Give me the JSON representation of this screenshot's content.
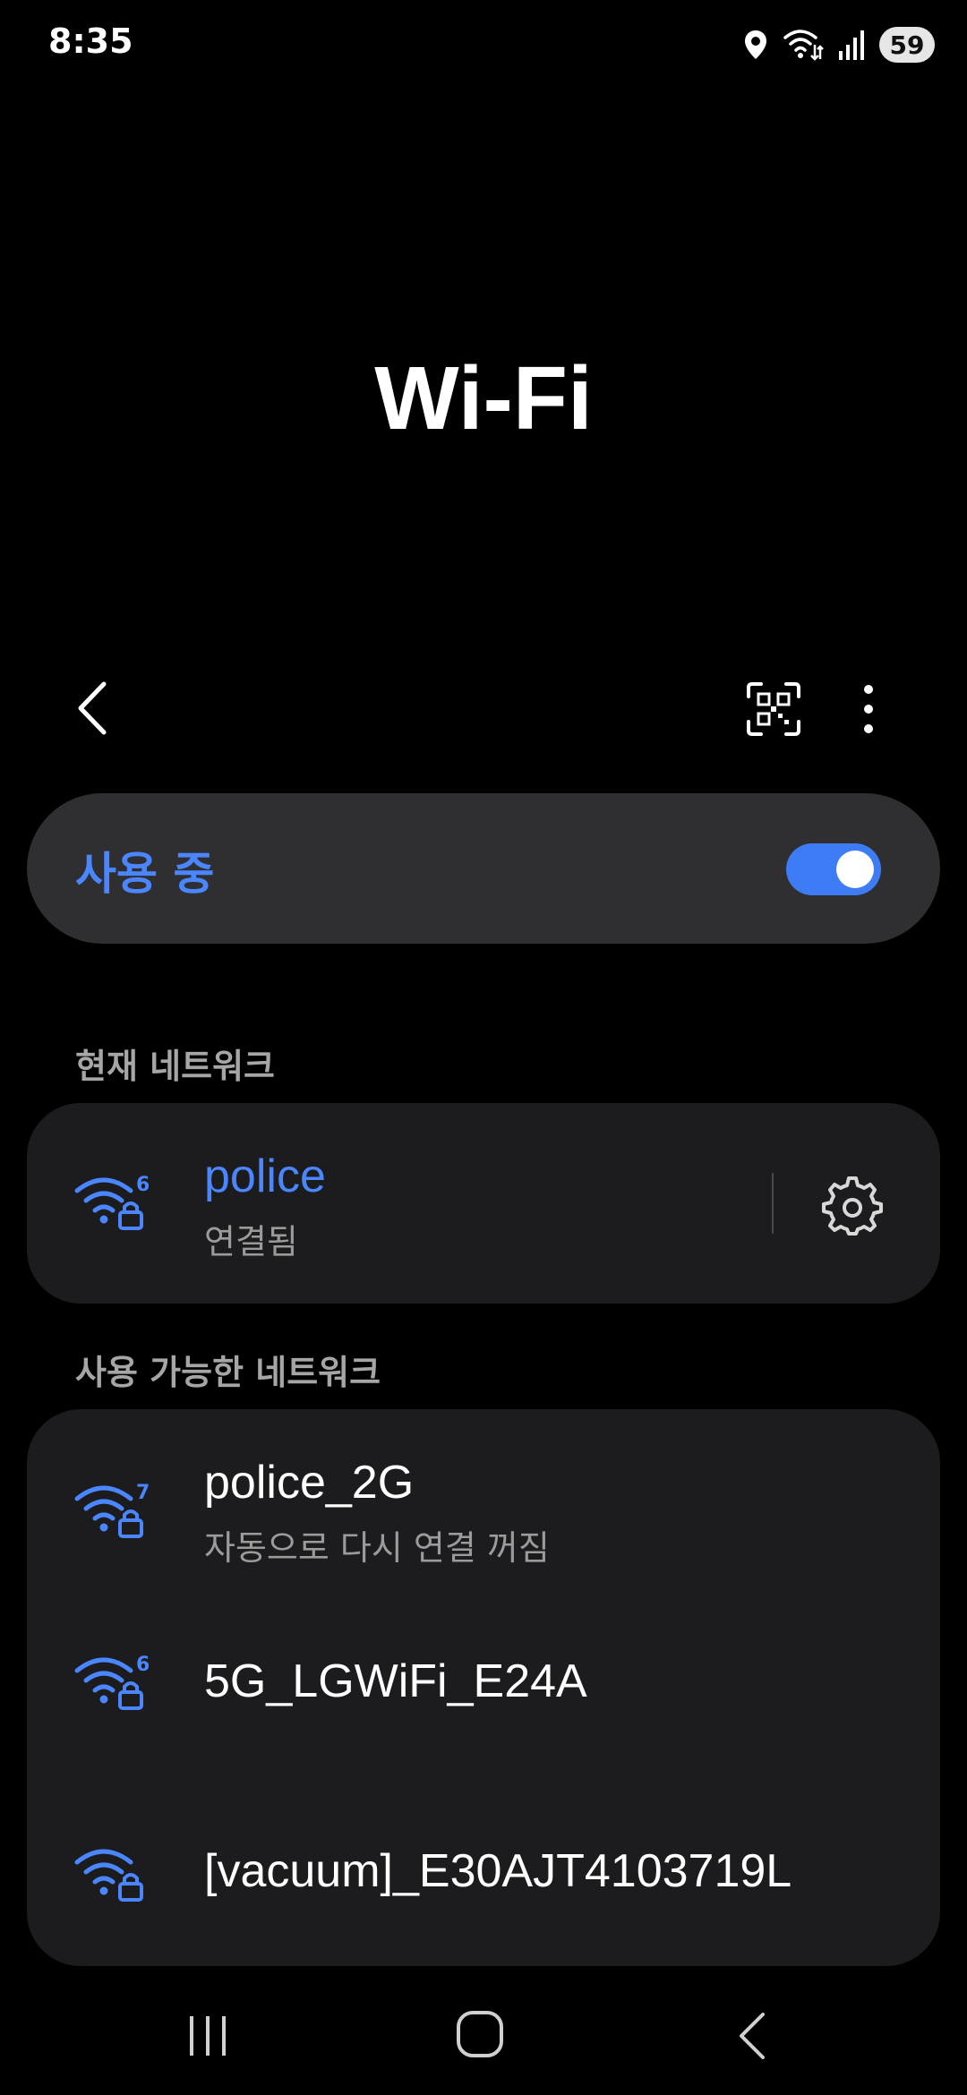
{
  "status_bar": {
    "time": "8:35",
    "battery": "59",
    "icons": [
      "location-icon",
      "wifi-data-icon",
      "signal-icon"
    ]
  },
  "page": {
    "title": "Wi-Fi"
  },
  "toolbar": {
    "icons": [
      "back-icon",
      "qr-scan-icon",
      "more-options-icon"
    ]
  },
  "master_toggle": {
    "label": "사용 중",
    "state": "on",
    "accent_color": "#3e7cf5"
  },
  "current_network": {
    "header": "현재 네트워크",
    "name": "police",
    "status": "연결됨",
    "wifi_generation": "6"
  },
  "available_networks": {
    "header": "사용 가능한 네트워크",
    "items": [
      {
        "name": "police_2G",
        "status": "자동으로 다시 연결 꺼짐",
        "wifi_generation": "7"
      },
      {
        "name": "5G_LGWiFi_E24A",
        "status": "",
        "wifi_generation": "6"
      },
      {
        "name": "[vacuum]_E30AJT4103719L",
        "status": "",
        "wifi_generation": ""
      }
    ]
  },
  "nav_bar": {
    "icons": [
      "recents-icon",
      "home-icon",
      "back-nav-icon"
    ]
  }
}
